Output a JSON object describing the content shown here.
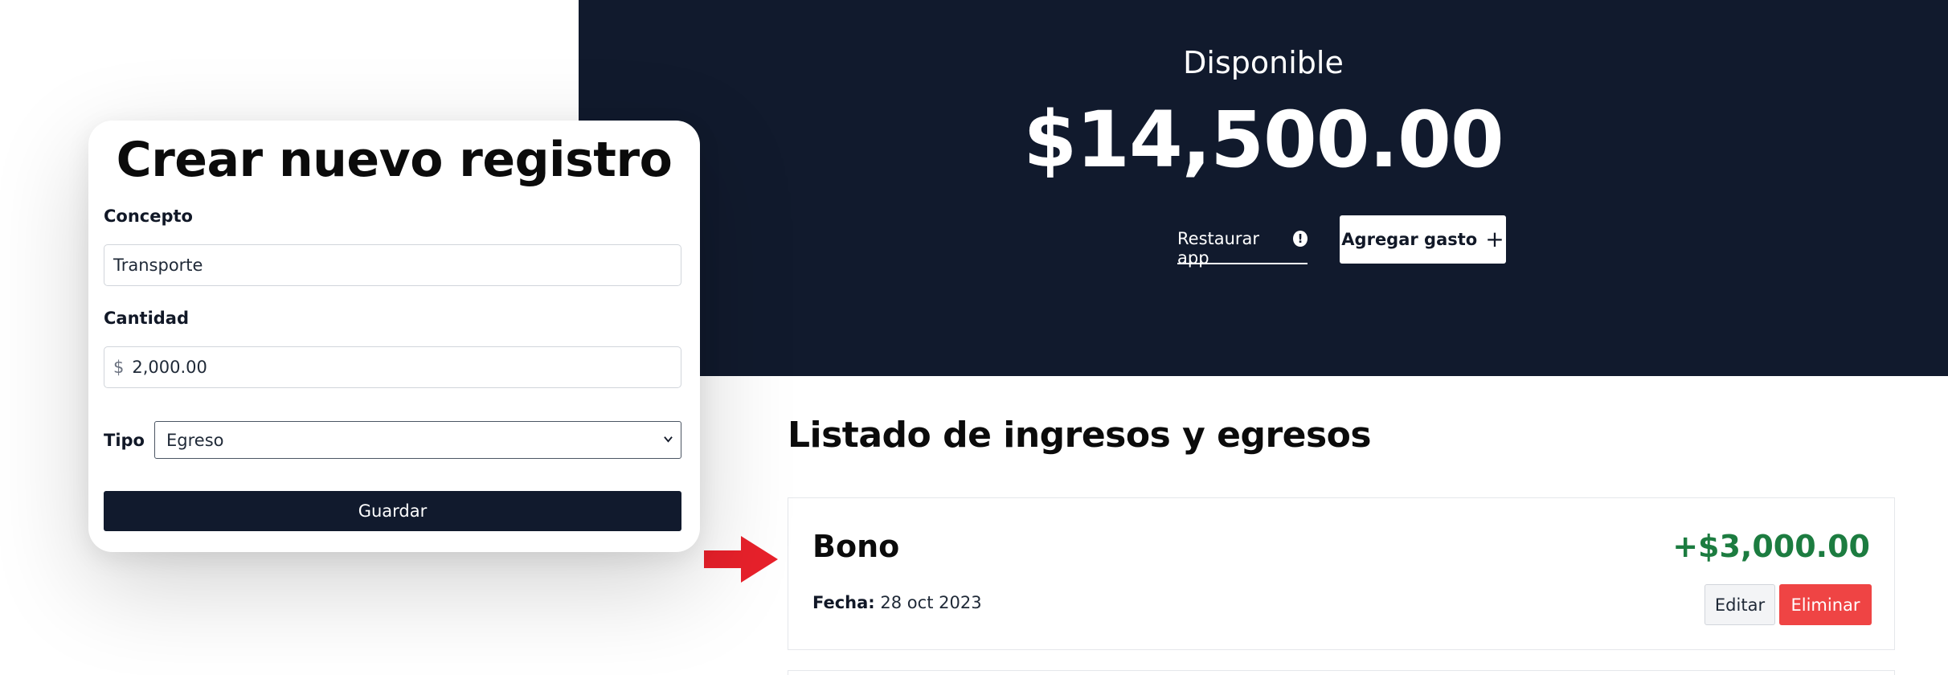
{
  "summary": {
    "label": "Disponible",
    "amount": "$14,500.00"
  },
  "header_actions": {
    "restore_label": "Restaurar app",
    "restore_icon": "info-circle-icon",
    "add_label": "Agregar gasto",
    "add_icon": "plus-icon"
  },
  "listing": {
    "title": "Listado de ingresos y egresos",
    "items": [
      {
        "name": "Bono",
        "amount": "+$3,000.00",
        "date_label": "Fecha:",
        "date_value": "28 oct 2023",
        "edit_label": "Editar",
        "delete_label": "Eliminar"
      }
    ]
  },
  "form": {
    "title": "Crear nuevo registro",
    "concepto_label": "Concepto",
    "concepto_value": "Transporte",
    "cantidad_label": "Cantidad",
    "currency_symbol": "$",
    "cantidad_value": "2,000.00",
    "tipo_label": "Tipo",
    "tipo_value": "Egreso",
    "save_label": "Guardar"
  },
  "colors": {
    "header_bg": "#111a2d",
    "positive_amount": "#1c7c40",
    "delete_button": "#ef4444",
    "arrow": "#e8212b"
  }
}
